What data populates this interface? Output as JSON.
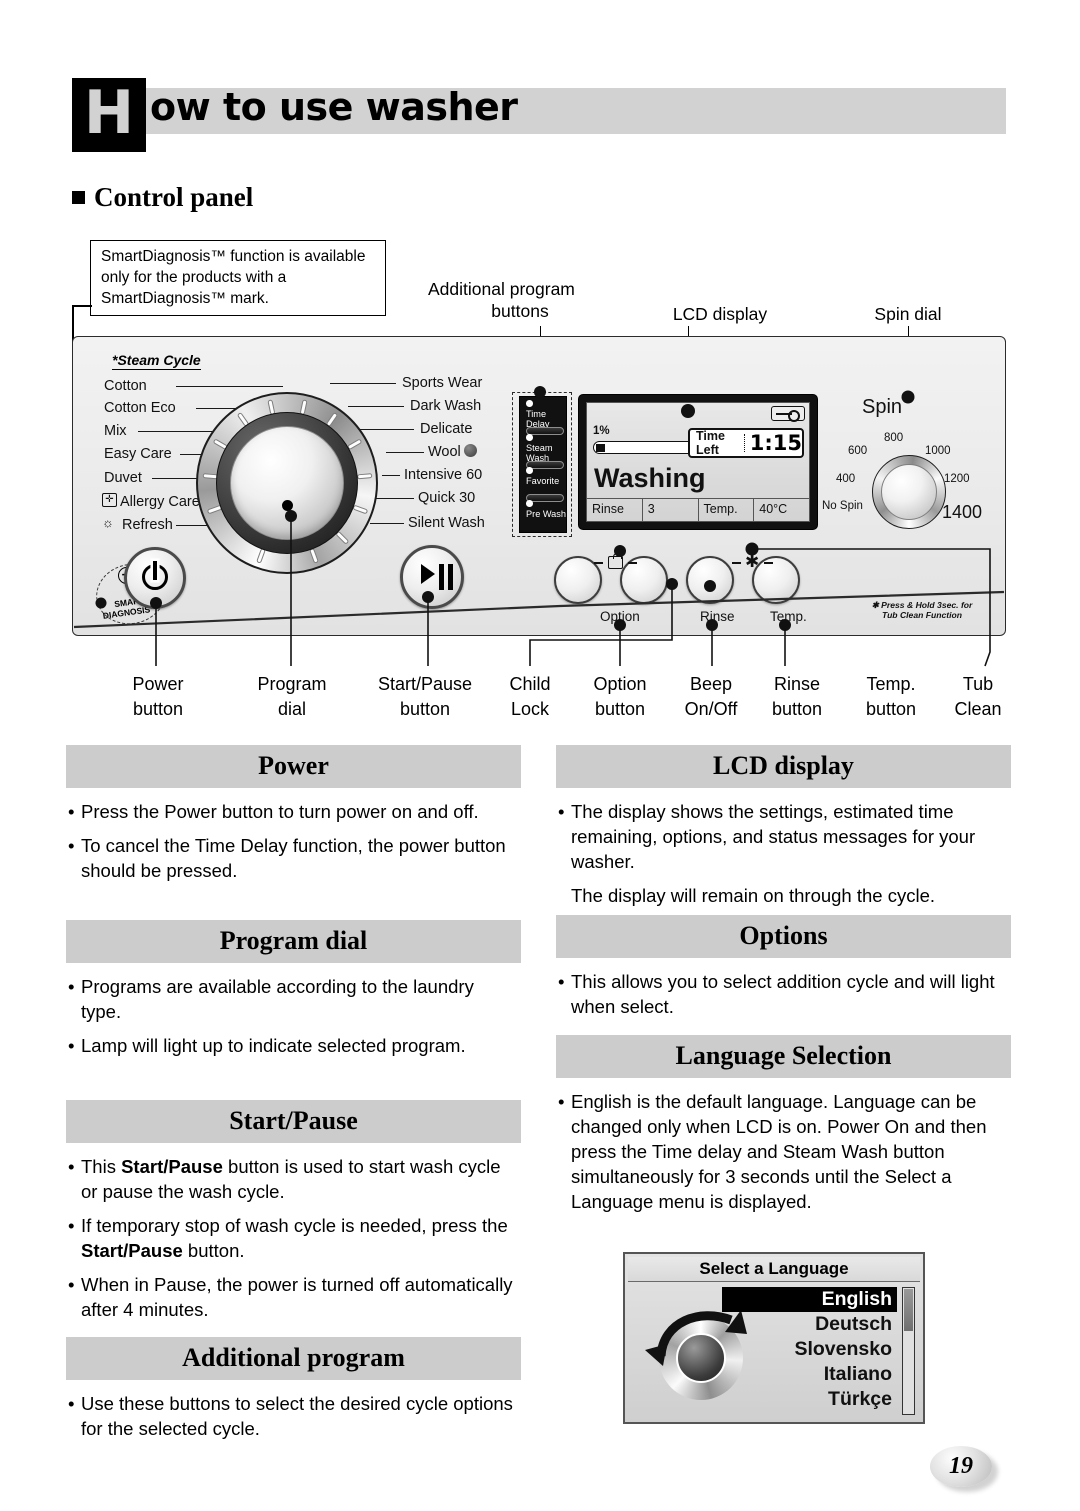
{
  "header": {
    "initial": "H",
    "rest": "ow to use washer"
  },
  "section_title": "Control panel",
  "note": "SmartDiagnosis™ function is available only for the products with a SmartDiagnosis™ mark.",
  "top_labels": {
    "additional_program_buttons_line1": "Additional program",
    "additional_program_buttons_line2": "buttons",
    "lcd_display": "LCD display",
    "spin_dial": "Spin dial"
  },
  "panel": {
    "steam_cycle_note": "*Steam Cycle",
    "programs_left": [
      "Cotton",
      "Cotton Eco",
      "Mix",
      "Easy Care",
      "Duvet",
      "Allergy Care",
      "Refresh"
    ],
    "programs_right": [
      "Sports Wear",
      "Dark Wash",
      "Delicate",
      "Wool",
      "Intensive 60",
      "Quick 30",
      "Silent Wash"
    ],
    "smart_diagnosis_line1": "SMART",
    "smart_diagnosis_line2": "DIAGNOSIS™",
    "additional_buttons": [
      "Time Delay",
      "Steam Wash",
      "Favorite",
      "Pre Wash"
    ],
    "lcd": {
      "percent": "1%",
      "time_left_label": "Time Left",
      "time_left_value": "1:15",
      "status": "Washing",
      "rinse_label": "Rinse",
      "rinse_value": "3",
      "temp_label": "Temp.",
      "temp_value": "40°C"
    },
    "spin": {
      "title": "Spin",
      "values": [
        "No Spin",
        "400",
        "600",
        "800",
        "1000",
        "1200",
        "1400"
      ]
    },
    "option_buttons": [
      "Option",
      "Rinse",
      "Temp."
    ],
    "tub_clean_note_line1": "Press & Hold 3sec. for",
    "tub_clean_note_line2": "Tub Clean Function"
  },
  "bottom_labels": [
    {
      "l1": "Power",
      "l2": "button"
    },
    {
      "l1": "Program",
      "l2": "dial"
    },
    {
      "l1": "Start/Pause",
      "l2": "button"
    },
    {
      "l1": "Child",
      "l2": "Lock"
    },
    {
      "l1": "Option",
      "l2": "button"
    },
    {
      "l1": "Beep",
      "l2": "On/Off"
    },
    {
      "l1": "Rinse",
      "l2": "button"
    },
    {
      "l1": "Temp.",
      "l2": "button"
    },
    {
      "l1": "Tub",
      "l2": "Clean"
    }
  ],
  "sections": {
    "power": {
      "title": "Power",
      "bullets": [
        "Press the Power button to turn power on and off.",
        "To cancel the Time Delay function, the power button should be pressed."
      ]
    },
    "program_dial": {
      "title": "Program dial",
      "bullets": [
        "Programs are available according to the laundry type.",
        "Lamp will light up to indicate selected program."
      ]
    },
    "start_pause": {
      "title": "Start/Pause",
      "bullets": [
        "This Start/Pause button is used to start wash cycle or pause the wash cycle.",
        "If temporary stop of wash cycle is needed, press the Start/Pause button.",
        "When in Pause, the power is turned off automatically after 4 minutes."
      ]
    },
    "additional_program": {
      "title": "Additional program",
      "bullets": [
        "Use these buttons to select the desired cycle options for the selected cycle."
      ]
    },
    "lcd_display": {
      "title": "LCD display",
      "bullets": [
        "The display shows the settings, estimated time remaining, options, and status messages for your washer."
      ],
      "plain": "The display will remain on through the cycle."
    },
    "options": {
      "title": "Options",
      "bullets": [
        "This allows you to select addition cycle and will light when select."
      ]
    },
    "language_selection": {
      "title": "Language Selection",
      "bullets": [
        "English is the default language. Language can be changed only when LCD is on. Power On and then press the Time delay and Steam Wash button simultaneously for 3 seconds until the Select a Language menu is displayed."
      ]
    }
  },
  "language_screen": {
    "title": "Select a Language",
    "items": [
      "English",
      "Deutsch",
      "Slovensko",
      "Italiano",
      "Türkçe"
    ],
    "selected": "English"
  },
  "page_number": "19",
  "colors": {
    "band": "#cccccc",
    "header_band": "#d2d2d2",
    "ink": "#000000"
  }
}
